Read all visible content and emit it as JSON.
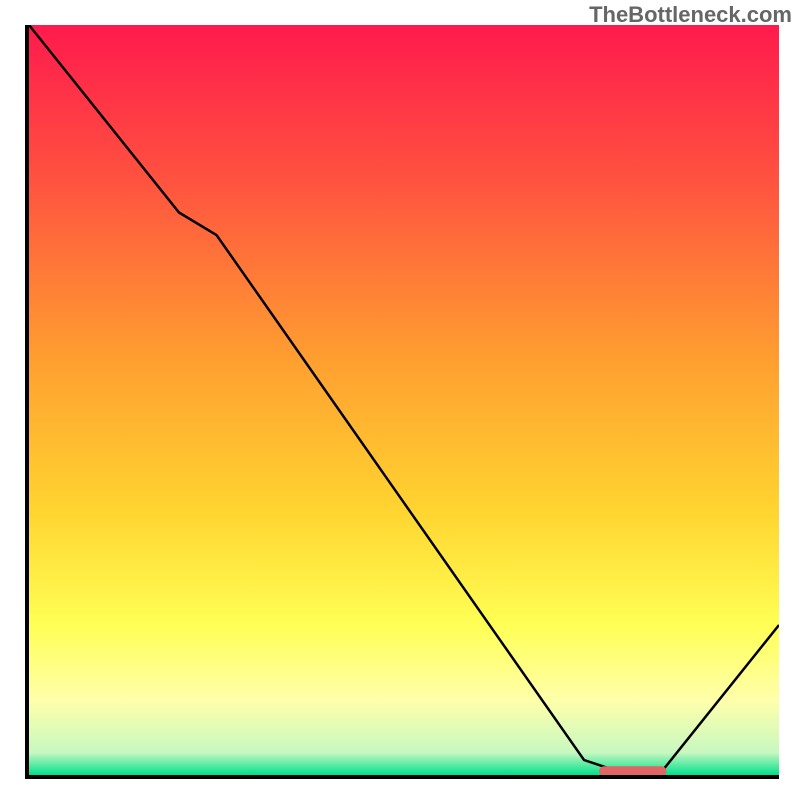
{
  "watermark": "TheBottleneck.com",
  "chart_data": {
    "type": "line",
    "title": "",
    "xlabel": "",
    "ylabel": "",
    "xlim": [
      0,
      100
    ],
    "ylim": [
      0,
      100
    ],
    "series": [
      {
        "name": "bottleneck-curve",
        "x": [
          0,
          20,
          25,
          74,
          80,
          84,
          100
        ],
        "y": [
          100,
          75,
          72,
          2,
          0,
          0,
          20
        ],
        "color": "#000000"
      }
    ],
    "marker": {
      "name": "optimal-segment",
      "x_start": 76,
      "x_end": 85,
      "y": 0.5,
      "color": "#e06666"
    },
    "background_gradient": {
      "stops": [
        {
          "offset": 0.0,
          "color": "#ff1a4d"
        },
        {
          "offset": 0.2,
          "color": "#ff5040"
        },
        {
          "offset": 0.45,
          "color": "#ffa030"
        },
        {
          "offset": 0.65,
          "color": "#ffd530"
        },
        {
          "offset": 0.8,
          "color": "#ffff55"
        },
        {
          "offset": 0.9,
          "color": "#ffffaa"
        },
        {
          "offset": 0.97,
          "color": "#c8f8c0"
        },
        {
          "offset": 1.0,
          "color": "#00e08c"
        }
      ]
    }
  }
}
